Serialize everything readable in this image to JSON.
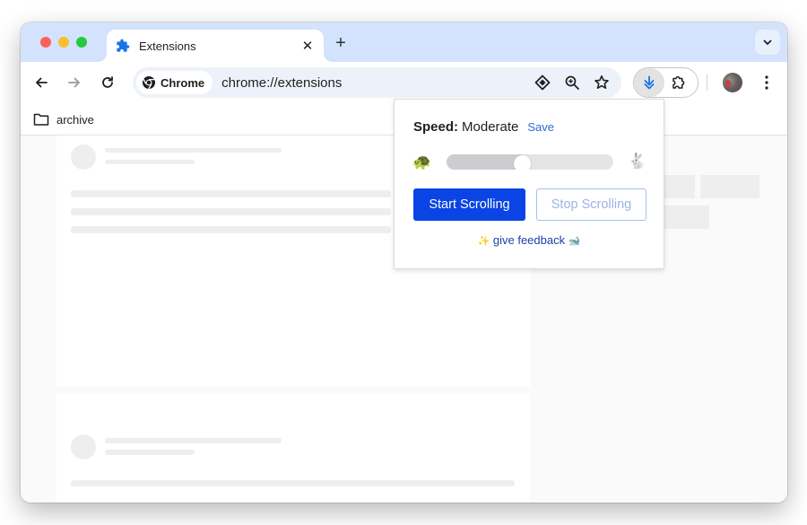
{
  "browser": {
    "tab": {
      "title": "Extensions",
      "icon": "puzzle-icon",
      "close_glyph": "✕"
    },
    "new_tab_glyph": "+",
    "tab_search_icon": "chevron-down-icon",
    "toolbar": {
      "back_icon": "arrow-left-icon",
      "forward_icon": "arrow-right-icon",
      "reload_icon": "reload-icon",
      "omnibox": {
        "chip_label": "Chrome",
        "url": "chrome://extensions",
        "icons": [
          "lens-icon",
          "zoom-icon",
          "star-icon"
        ]
      },
      "extensions": [
        "auto-scroll-extension-icon",
        "extensions-puzzle-icon"
      ],
      "avatar": "profile-avatar",
      "menu_icon": "kebab-menu-icon"
    },
    "bookmarks": [
      {
        "label": "archive",
        "icon": "folder-icon"
      }
    ]
  },
  "popup": {
    "speed_label": "Speed:",
    "speed_value": "Moderate",
    "save_label": "Save",
    "slider": {
      "min_icon": "🐢",
      "max_icon": "🐇",
      "value_fraction": 0.45
    },
    "start_button": "Start Scrolling",
    "stop_button": "Stop Scrolling",
    "feedback": {
      "prefix_emoji": "✨",
      "label": "give feedback",
      "suffix_emoji": "🐋"
    }
  },
  "colors": {
    "accent": "#0a44e4",
    "link": "#2f6bd7",
    "tabstrip": "#d3e3fd",
    "extension_icon": "#1a73e8"
  }
}
